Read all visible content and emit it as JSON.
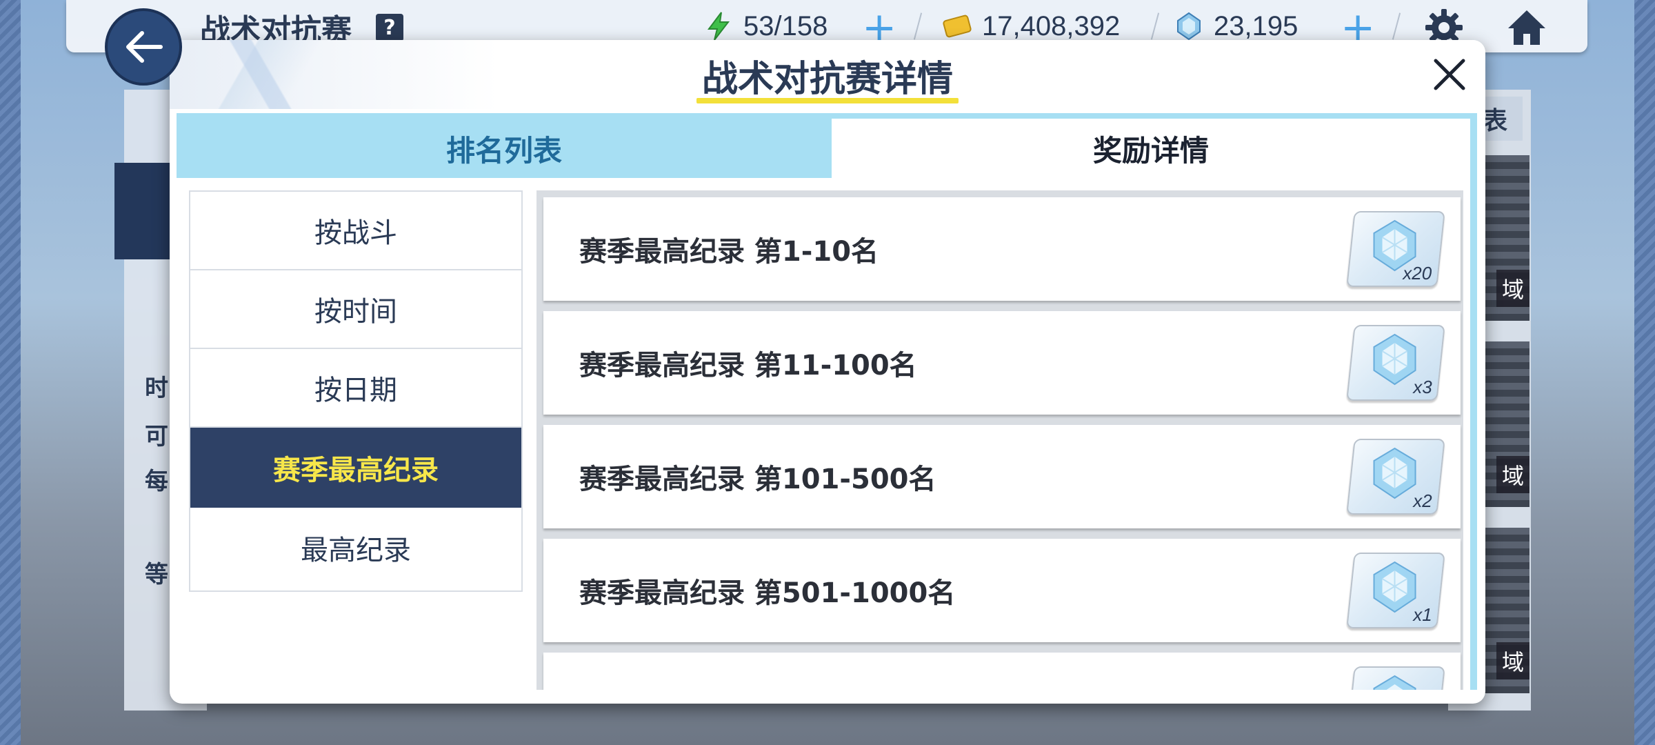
{
  "topbar": {
    "title": "战术对抗赛",
    "help_icon": "?",
    "stamina": "53/158",
    "credits": "17,408,392",
    "gems": "23,195",
    "plus": "+"
  },
  "background": {
    "side_texts": [
      "时",
      "可",
      "每",
      "等"
    ],
    "right_tab": "表",
    "tile_tag": "域"
  },
  "modal": {
    "title": "战术对抗赛详情",
    "tabs": {
      "ranking": "排名列表",
      "reward": "奖励详情"
    },
    "sort_options": [
      {
        "label": "按战斗",
        "active": false
      },
      {
        "label": "按时间",
        "active": false
      },
      {
        "label": "按日期",
        "active": false
      },
      {
        "label": "赛季最高纪录",
        "active": true
      },
      {
        "label": "最高纪录",
        "active": false
      }
    ],
    "rewards": [
      {
        "label": "赛季最高纪录 第1-10名",
        "count": "x20"
      },
      {
        "label": "赛季最高纪录 第11-100名",
        "count": "x3"
      },
      {
        "label": "赛季最高纪录 第101-500名",
        "count": "x2"
      },
      {
        "label": "赛季最高纪录 第501-1000名",
        "count": "x1"
      },
      {
        "label": "",
        "count": ""
      }
    ]
  },
  "colors": {
    "accent_yellow": "#f7e64a",
    "active_bg": "#2e4166",
    "tab_blue": "#a7dff3",
    "plus_blue": "#4aa3e8"
  },
  "icons": {
    "back": "back-arrow-icon",
    "help": "help-icon",
    "stamina": "lightning-icon",
    "credits": "credit-card-icon",
    "gems": "gem-icon",
    "settings": "gear-icon",
    "home": "home-icon",
    "close": "close-icon",
    "reward": "pyroxene-gem-icon"
  }
}
